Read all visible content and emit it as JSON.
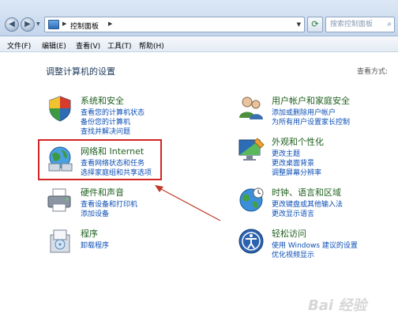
{
  "address": {
    "crumb": "控制面板"
  },
  "search": {
    "placeholder": "搜索控制面板"
  },
  "menu": [
    "文件(F)",
    "编辑(E)",
    "查看(V)",
    "工具(T)",
    "帮助(H)"
  ],
  "content": {
    "heading": "调整计算机的设置",
    "view_label": "查看方式:"
  },
  "categories": {
    "system": {
      "title": "系统和安全",
      "links": [
        "查看您的计算机状态",
        "备份您的计算机",
        "查找并解决问题"
      ]
    },
    "network": {
      "title": "网络和 Internet",
      "links": [
        "查看网络状态和任务",
        "选择家庭组和共享选项"
      ]
    },
    "hardware": {
      "title": "硬件和声音",
      "links": [
        "查看设备和打印机",
        "添加设备"
      ]
    },
    "programs": {
      "title": "程序",
      "links": [
        "卸载程序"
      ]
    },
    "users": {
      "title": "用户帐户和家庭安全",
      "links": [
        "添加或删除用户帐户",
        "为所有用户设置家长控制"
      ]
    },
    "appearance": {
      "title": "外观和个性化",
      "links": [
        "更改主题",
        "更改桌面背景",
        "调整屏幕分辨率"
      ]
    },
    "clock": {
      "title": "时钟、语言和区域",
      "links": [
        "更改键盘或其他输入法",
        "更改显示语言"
      ]
    },
    "ease": {
      "title": "轻松访问",
      "links": [
        "使用 Windows 建议的设置",
        "优化视频显示"
      ]
    }
  },
  "watermark": "Bai 经验",
  "colors": {
    "highlight": "#d32424",
    "link": "#0b4eb5",
    "category_title": "#1e5f1e"
  }
}
